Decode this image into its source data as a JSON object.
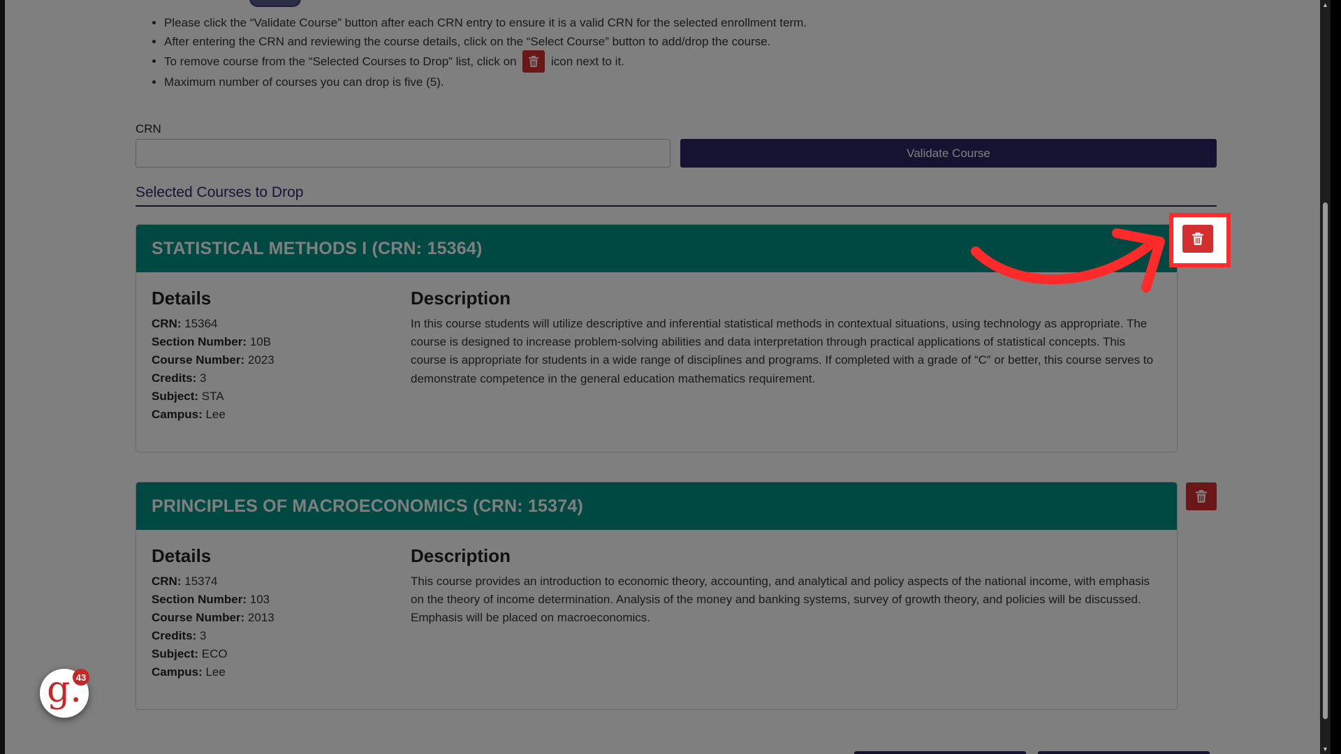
{
  "instructions": [
    "Please click the “Validate Course” button after each CRN entry to ensure it is a valid CRN for the selected enrollment term.",
    "After entering the CRN and reviewing the course details, click on the “Select Course” button to add/drop the course.",
    {
      "before": "To remove course from the “Selected Courses to Drop” list, click on",
      "icon": "trash-icon",
      "after": "icon next to it."
    },
    "Maximum number of courses you can drop is five (5)."
  ],
  "crn_field": {
    "label": "CRN",
    "value": "",
    "placeholder": ""
  },
  "validate_button": {
    "label": "Validate Course"
  },
  "selected_section": {
    "title": "Selected Courses to Drop"
  },
  "courses": [
    {
      "header": "STATISTICAL METHODS I  (CRN: 15364)",
      "details_title": "Details",
      "description_title": "Description",
      "fields": [
        {
          "key": "CRN:",
          "value": "15364"
        },
        {
          "key": "Section Number:",
          "value": "10B"
        },
        {
          "key": "Course Number:",
          "value": "2023"
        },
        {
          "key": "Credits:",
          "value": "3"
        },
        {
          "key": "Subject:",
          "value": "STA"
        },
        {
          "key": "Campus:",
          "value": "Lee"
        }
      ],
      "description": "In this course students will utilize descriptive and inferential statistical methods in contextual situations, using technology as appropriate. The course is designed to increase problem-solving abilities and data interpretation through practical applications of statistical concepts. This course is appropriate for students in a wide range of disciplines and programs. If completed with a grade of “C” or better, this course serves to demonstrate competence in the general education mathematics requirement.",
      "remove_icon": "trash-icon",
      "highlighted": true
    },
    {
      "header": "PRINCIPLES OF MACROECONOMICS  (CRN: 15374)",
      "details_title": "Details",
      "description_title": "Description",
      "fields": [
        {
          "key": "CRN:",
          "value": "15374"
        },
        {
          "key": "Section Number:",
          "value": "103"
        },
        {
          "key": "Course Number:",
          "value": "2013"
        },
        {
          "key": "Credits:",
          "value": "3"
        },
        {
          "key": "Subject:",
          "value": "ECO"
        },
        {
          "key": "Campus:",
          "value": "Lee"
        }
      ],
      "description": "This course provides an introduction to economic theory, accounting, and analytical and policy aspects of the national income, with emphasis on the theory of income determination. Analysis of the money and banking systems, survey of growth theory, and policies will be discussed. Emphasis will be placed on macroeconomics.",
      "remove_icon": "trash-icon",
      "highlighted": false
    }
  ],
  "annotation": {
    "arrow_icon": "curved-arrow-icon",
    "color": "#ff2b2b"
  },
  "assistant_widget": {
    "logo_text": "g.",
    "badge_count": "43"
  },
  "colors": {
    "card_header": "#009384",
    "primary_button": "#2b2464",
    "delete_button": "#d32f2f",
    "overlay": "rgba(0,0,0,0.5)"
  }
}
